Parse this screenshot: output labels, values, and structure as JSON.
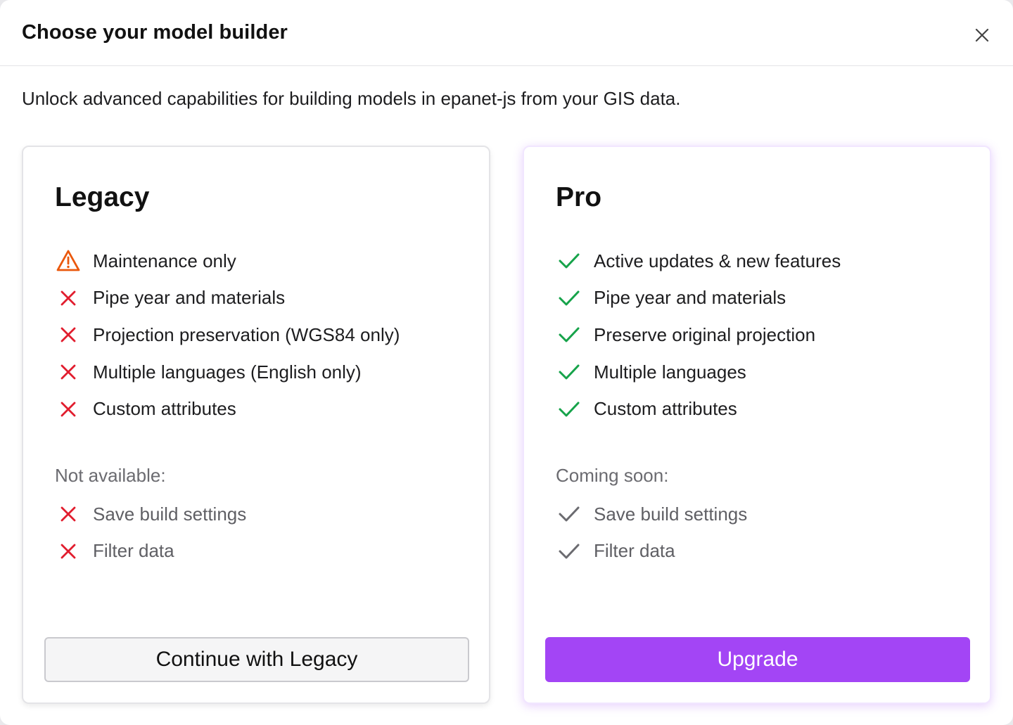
{
  "dialog": {
    "title": "Choose your model builder",
    "description": "Unlock advanced capabilities for building models in epanet-js from your GIS data.",
    "close_icon": "close-icon"
  },
  "legacy": {
    "title": "Legacy",
    "features": [
      {
        "icon": "warning-icon",
        "label": "Maintenance only"
      },
      {
        "icon": "x-icon",
        "label": "Pipe year and materials"
      },
      {
        "icon": "x-icon",
        "label": "Projection preservation (WGS84 only)"
      },
      {
        "icon": "x-icon",
        "label": "Multiple languages (English only)"
      },
      {
        "icon": "x-icon",
        "label": "Custom attributes"
      }
    ],
    "section_label": "Not available:",
    "sub_features": [
      {
        "icon": "x-icon",
        "label": "Save build settings"
      },
      {
        "icon": "x-icon",
        "label": "Filter data"
      }
    ],
    "button_label": "Continue with Legacy"
  },
  "pro": {
    "title": "Pro",
    "features": [
      {
        "icon": "check-icon",
        "label": "Active updates & new features"
      },
      {
        "icon": "check-icon",
        "label": "Pipe year and materials"
      },
      {
        "icon": "check-icon",
        "label": "Preserve original projection"
      },
      {
        "icon": "check-icon",
        "label": "Multiple languages"
      },
      {
        "icon": "check-icon",
        "label": "Custom attributes"
      }
    ],
    "section_label": "Coming soon:",
    "sub_features": [
      {
        "icon": "check-icon",
        "label": "Save build settings"
      },
      {
        "icon": "check-icon",
        "label": "Filter data"
      }
    ],
    "button_label": "Upgrade"
  },
  "colors": {
    "accent": "#a345f5",
    "check": "#16a34a",
    "cross": "#e11d2e",
    "warning": "#ea580c",
    "muted_check": "#6b6b70"
  }
}
